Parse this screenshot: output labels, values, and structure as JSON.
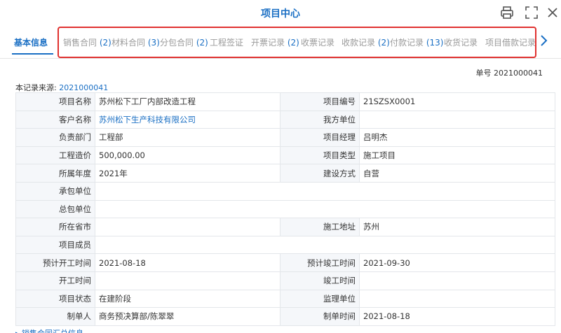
{
  "window": {
    "title": "项目中心",
    "icons": [
      "printer-icon",
      "fullscreen-icon",
      "close-icon"
    ]
  },
  "tabs": {
    "active": "基本信息",
    "items": [
      {
        "label": "销售合同",
        "count": "(2)"
      },
      {
        "label": "材料合同",
        "count": "(3)"
      },
      {
        "label": "分包合同",
        "count": "(2)"
      },
      {
        "label": "工程签证",
        "count": ""
      },
      {
        "label": "开票记录",
        "count": "(2)"
      },
      {
        "label": "收票记录",
        "count": ""
      },
      {
        "label": "收款记录",
        "count": "(2)"
      },
      {
        "label": "付款记录",
        "count": "(13)"
      },
      {
        "label": "收货记录",
        "count": ""
      },
      {
        "label": "项目借款记录",
        "count": ""
      }
    ]
  },
  "header": {
    "doc_no": "单号 2021000041",
    "source_label": "本记录来源:",
    "source_value": "2021000041"
  },
  "fields": {
    "project_name": {
      "label": "项目名称",
      "value": "苏州松下工厂内部改造工程"
    },
    "project_no": {
      "label": "项目编号",
      "value": "21SZSX0001"
    },
    "customer": {
      "label": "客户名称",
      "value": "苏州松下生产科技有限公司"
    },
    "our_unit": {
      "label": "我方单位",
      "value": ""
    },
    "dept": {
      "label": "负责部门",
      "value": "工程部"
    },
    "manager": {
      "label": "项目经理",
      "value": "吕明杰"
    },
    "cost": {
      "label": "工程造价",
      "value": "500,000.00"
    },
    "type": {
      "label": "项目类型",
      "value": "施工项目"
    },
    "year": {
      "label": "所属年度",
      "value": "2021年"
    },
    "build_mode": {
      "label": "建设方式",
      "value": "自营"
    },
    "contractor": {
      "label": "承包单位",
      "value": ""
    },
    "general_contractor": {
      "label": "总包单位",
      "value": ""
    },
    "province": {
      "label": "所在省市",
      "value": ""
    },
    "site": {
      "label": "施工地址",
      "value": "苏州"
    },
    "members": {
      "label": "项目成员",
      "value": ""
    },
    "plan_start": {
      "label": "预计开工时间",
      "value": "2021-08-18"
    },
    "plan_end": {
      "label": "预计竣工时间",
      "value": "2021-09-30"
    },
    "start": {
      "label": "开工时间",
      "value": ""
    },
    "end": {
      "label": "竣工时间",
      "value": ""
    },
    "status": {
      "label": "项目状态",
      "value": "在建阶段"
    },
    "supervisor": {
      "label": "监理单位",
      "value": ""
    },
    "creator": {
      "label": "制单人",
      "value": "商务预决算部/陈翠翠"
    },
    "created_at": {
      "label": "制单时间",
      "value": "2021-08-18"
    }
  },
  "footer": {
    "peek": "▸ 销售合同汇总信息"
  }
}
